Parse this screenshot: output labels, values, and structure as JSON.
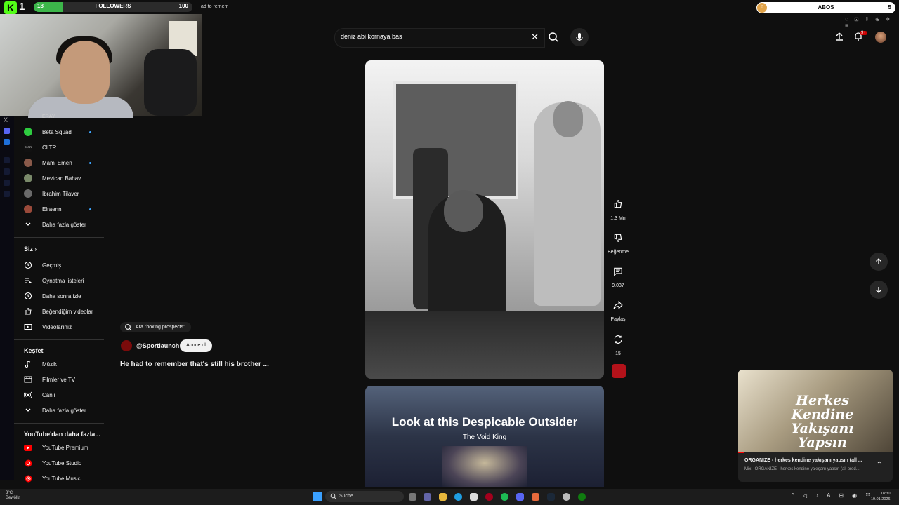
{
  "overlay": {
    "kick_count": "1",
    "followers": {
      "current": "18",
      "label": "FOLLOWERS",
      "goal": "100",
      "fraction": 0.18
    },
    "tab_text": "ad to remem",
    "abos": {
      "current": "0",
      "label": "ABOS",
      "goal": "5"
    }
  },
  "header": {
    "search_value": "deniz abi kornaya bas",
    "notif_badge": "9+"
  },
  "sidebar": {
    "subscriptions_top_cut": "ERAY",
    "subscriptions": [
      {
        "label": "Beta Squad",
        "live": true,
        "color": "#2ecc40"
      },
      {
        "label": "CLTR",
        "live": false,
        "color": "#111111"
      },
      {
        "label": "Mami Emen",
        "live": true,
        "color": "#8a5a4a"
      },
      {
        "label": "Mevtcan Bahav",
        "live": false,
        "color": "#7a8a6a"
      },
      {
        "label": "İbrahim Tilaver",
        "live": false,
        "color": "#6a6a6a"
      },
      {
        "label": "Elraenn",
        "live": true,
        "color": "#9a4a3a"
      }
    ],
    "show_more": "Daha fazla göster",
    "you_heading": "Siz",
    "you_items": [
      "Geçmiş",
      "Oynatma listeleri",
      "Daha sonra izle",
      "Beğendiğim videolar",
      "Videolarınız"
    ],
    "explore_heading": "Keşfet",
    "explore_items": [
      "Müzik",
      "Filmler ve TV",
      "Canlı",
      "Daha fazla göster"
    ],
    "more_heading": "YouTube'dan daha fazla...",
    "more_items": [
      "YouTube Premium",
      "YouTube Studio",
      "YouTube Music"
    ]
  },
  "short": {
    "search_chip": "Ara \"boxing prospects\"",
    "channel": "@Sportlaunch",
    "subscribe": "Abone ol",
    "title": "He had to remember that's still his brother ...",
    "likes": "1,3 Mn",
    "dislike_label": "Beğenme",
    "comments": "9.037",
    "share_label": "Paylaş",
    "remix_count": "15"
  },
  "next_short": {
    "title": "Look at this Despicable Outsider",
    "subtitle": "The Void King"
  },
  "miniplayer": {
    "thumb_text": "Herkes Kendine Yakışanı Yapsın",
    "title": "ORGANIZE - herkes kendine yakışanı yapsın (all ...",
    "subtitle": "Mix - ORGANIZE - herkes kendine yakışanı yapsın (all prod...",
    "progress": 0.04
  },
  "taskbar": {
    "weather_temp": "3°C",
    "weather_desc": "Bewölkt",
    "search_label": "Suche",
    "time": "18:30",
    "date": "19.01.2026"
  },
  "colors": {
    "accent": "#3ea6ff",
    "brand_red": "#ff0000",
    "kick_green": "#53fc18"
  }
}
